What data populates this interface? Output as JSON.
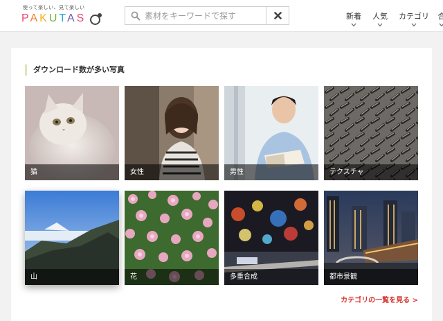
{
  "header": {
    "tagline": "使って楽しい、見て楽しい",
    "logo_text": "PAKUTASO",
    "search": {
      "placeholder": "素材をキーワードで探す",
      "value": ""
    },
    "nav": [
      {
        "label": "新着"
      },
      {
        "label": "人気"
      },
      {
        "label": "カテゴリ"
      },
      {
        "label": "合"
      }
    ],
    "colors": {
      "logo_p": "#e7496b",
      "logo_a": "#f0802f",
      "logo_k": "#f2b01e",
      "logo_u": "#6cb43f",
      "logo_t": "#2da5d8",
      "logo_a2": "#6a5fb0",
      "logo_s": "#e7496b"
    }
  },
  "main": {
    "section_title": "ダウンロード数が多い写真",
    "tiles": [
      {
        "label": "猫"
      },
      {
        "label": "女性"
      },
      {
        "label": "男性"
      },
      {
        "label": "テクスチャ"
      },
      {
        "label": "山"
      },
      {
        "label": "花"
      },
      {
        "label": "多重合成"
      },
      {
        "label": "都市景観"
      }
    ],
    "more_link": "カテゴリの一覧を見る >",
    "accent_color": "#d8332d"
  }
}
